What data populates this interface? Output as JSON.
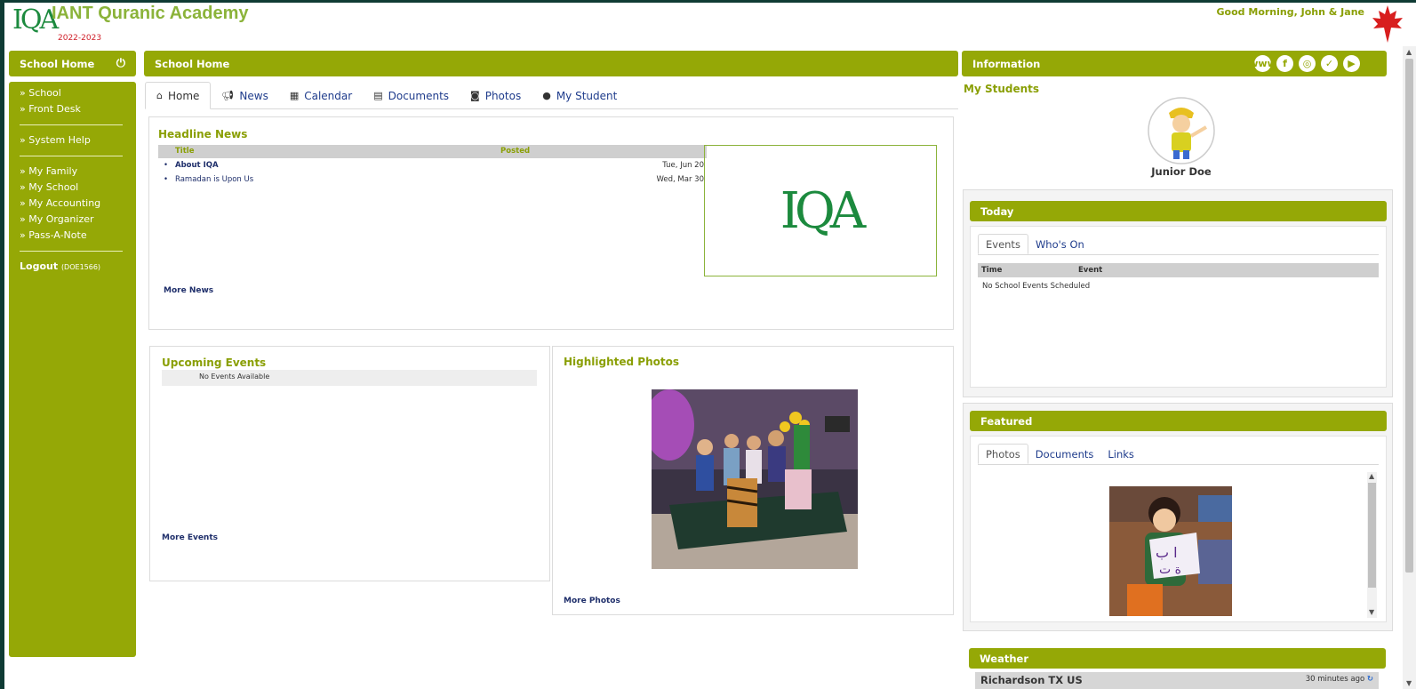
{
  "header": {
    "logo_text": "IQA",
    "title": "IANT Quranic Academy",
    "school_year": "2022-2023",
    "greeting": "Good Morning, John & Jane"
  },
  "sidebar": {
    "title": "School Home",
    "items": [
      "» School",
      "» Front Desk",
      "» System Help",
      "» My Family",
      "» My School",
      "» My Accounting",
      "» My Organizer",
      "» Pass-A-Note"
    ],
    "logout_label": "Logout",
    "logout_user": "(DOE1566)"
  },
  "main": {
    "title": "School Home",
    "tabs": [
      {
        "label": "Home",
        "icon": "home-icon"
      },
      {
        "label": "News",
        "icon": "megaphone-icon"
      },
      {
        "label": "Calendar",
        "icon": "calendar-icon"
      },
      {
        "label": "Documents",
        "icon": "document-icon"
      },
      {
        "label": "Photos",
        "icon": "camera-icon"
      },
      {
        "label": "My Student",
        "icon": "user-icon"
      }
    ],
    "headline": {
      "title": "Headline News",
      "col_title": "Title",
      "col_posted": "Posted",
      "rows": [
        {
          "title": "About IQA",
          "date": "Tue, Jun 20"
        },
        {
          "title": "Ramadan is Upon Us",
          "date": "Wed, Mar 30"
        }
      ],
      "more": "More News",
      "image_logo": "IQA"
    },
    "events": {
      "title": "Upcoming Events",
      "empty": "No Events Available",
      "more": "More Events"
    },
    "photos": {
      "title": "Highlighted Photos",
      "more": "More Photos"
    }
  },
  "info": {
    "title": "Information",
    "icons": [
      "web-icon",
      "facebook-icon",
      "instagram-icon",
      "twitter-icon",
      "youtube-icon"
    ],
    "my_students": "My Students",
    "student_name": "Junior Doe",
    "today": {
      "title": "Today",
      "tabs": [
        "Events",
        "Who's On"
      ],
      "col_time": "Time",
      "col_event": "Event",
      "empty": "No School Events Scheduled"
    },
    "featured": {
      "title": "Featured",
      "tabs": [
        "Photos",
        "Documents",
        "Links"
      ]
    },
    "weather": {
      "title": "Weather",
      "location": "Richardson TX US",
      "updated": "30 minutes ago"
    }
  },
  "colors": {
    "accent": "#95a806",
    "title_green": "#8bb33a",
    "link_blue": "#1f2f6b",
    "frame": "#0f3b34"
  }
}
